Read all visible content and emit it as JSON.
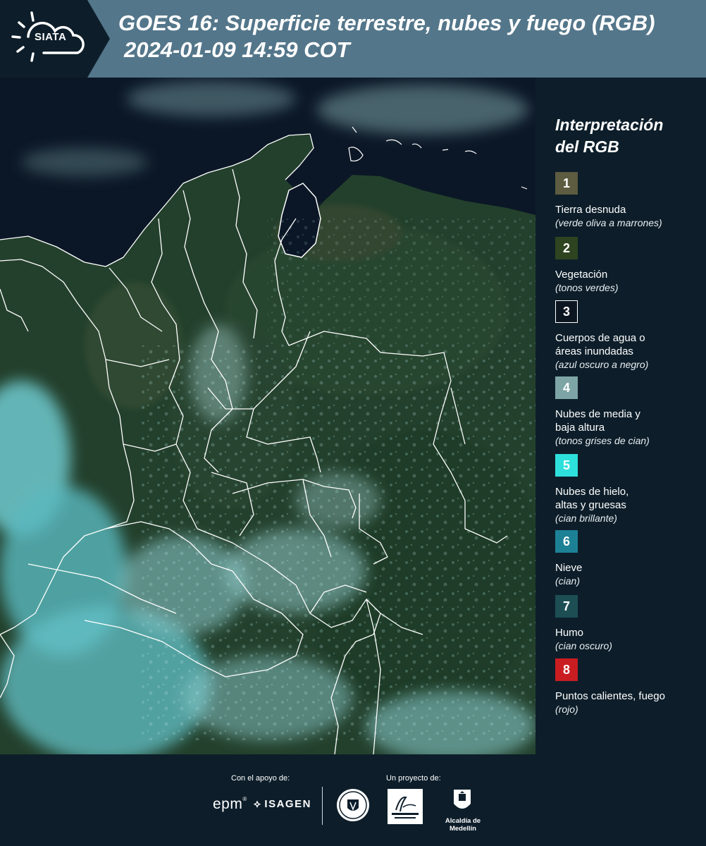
{
  "header": {
    "logo_text": "SIATA",
    "title_line1": "GOES 16: Superficie terrestre, nubes y fuego (RGB)",
    "title_line2": "2024-01-09 14:59 COT"
  },
  "legend": {
    "title_line1": "Interpretación",
    "title_line2": "del RGB",
    "items": [
      {
        "num": "1",
        "color": "#5d5b40",
        "label_lines": [
          "Tierra desnuda"
        ],
        "hint": "(verde oliva a marrones)"
      },
      {
        "num": "2",
        "color": "#2e4420",
        "label_lines": [
          "Vegetación"
        ],
        "hint": "(tonos verdes)"
      },
      {
        "num": "3",
        "color": "#0c1621",
        "label_lines": [
          "Cuerpos de agua o",
          "áreas inundadas"
        ],
        "hint": "(azul oscuro a negro)"
      },
      {
        "num": "4",
        "color": "#7ea5a6",
        "label_lines": [
          "Nubes de media y",
          "baja altura"
        ],
        "hint": "(tonos grises de cian)"
      },
      {
        "num": "5",
        "color": "#2ee0dc",
        "label_lines": [
          "Nubes de hielo,",
          "altas y gruesas"
        ],
        "hint": "(cian brillante)"
      },
      {
        "num": "6",
        "color": "#1d8196",
        "label_lines": [
          "Nieve"
        ],
        "hint": "(cian)"
      },
      {
        "num": "7",
        "color": "#1c4e54",
        "label_lines": [
          "Humo"
        ],
        "hint": "(cian oscuro)"
      },
      {
        "num": "8",
        "color": "#c91d22",
        "label_lines": [
          "Puntos calientes, fuego"
        ],
        "hint": "(rojo)"
      }
    ]
  },
  "footer": {
    "support_label": "Con el apoyo de:",
    "project_label": "Un proyecto de:",
    "epm": "epm",
    "isagen": "ISAGEN",
    "medellin": "Alcaldía de Medellín"
  },
  "map": {
    "ocean_color": "#0b1726",
    "land_color": "#23402c",
    "cloud_color": "#6fc9cf",
    "border_color": "#ffffff"
  }
}
